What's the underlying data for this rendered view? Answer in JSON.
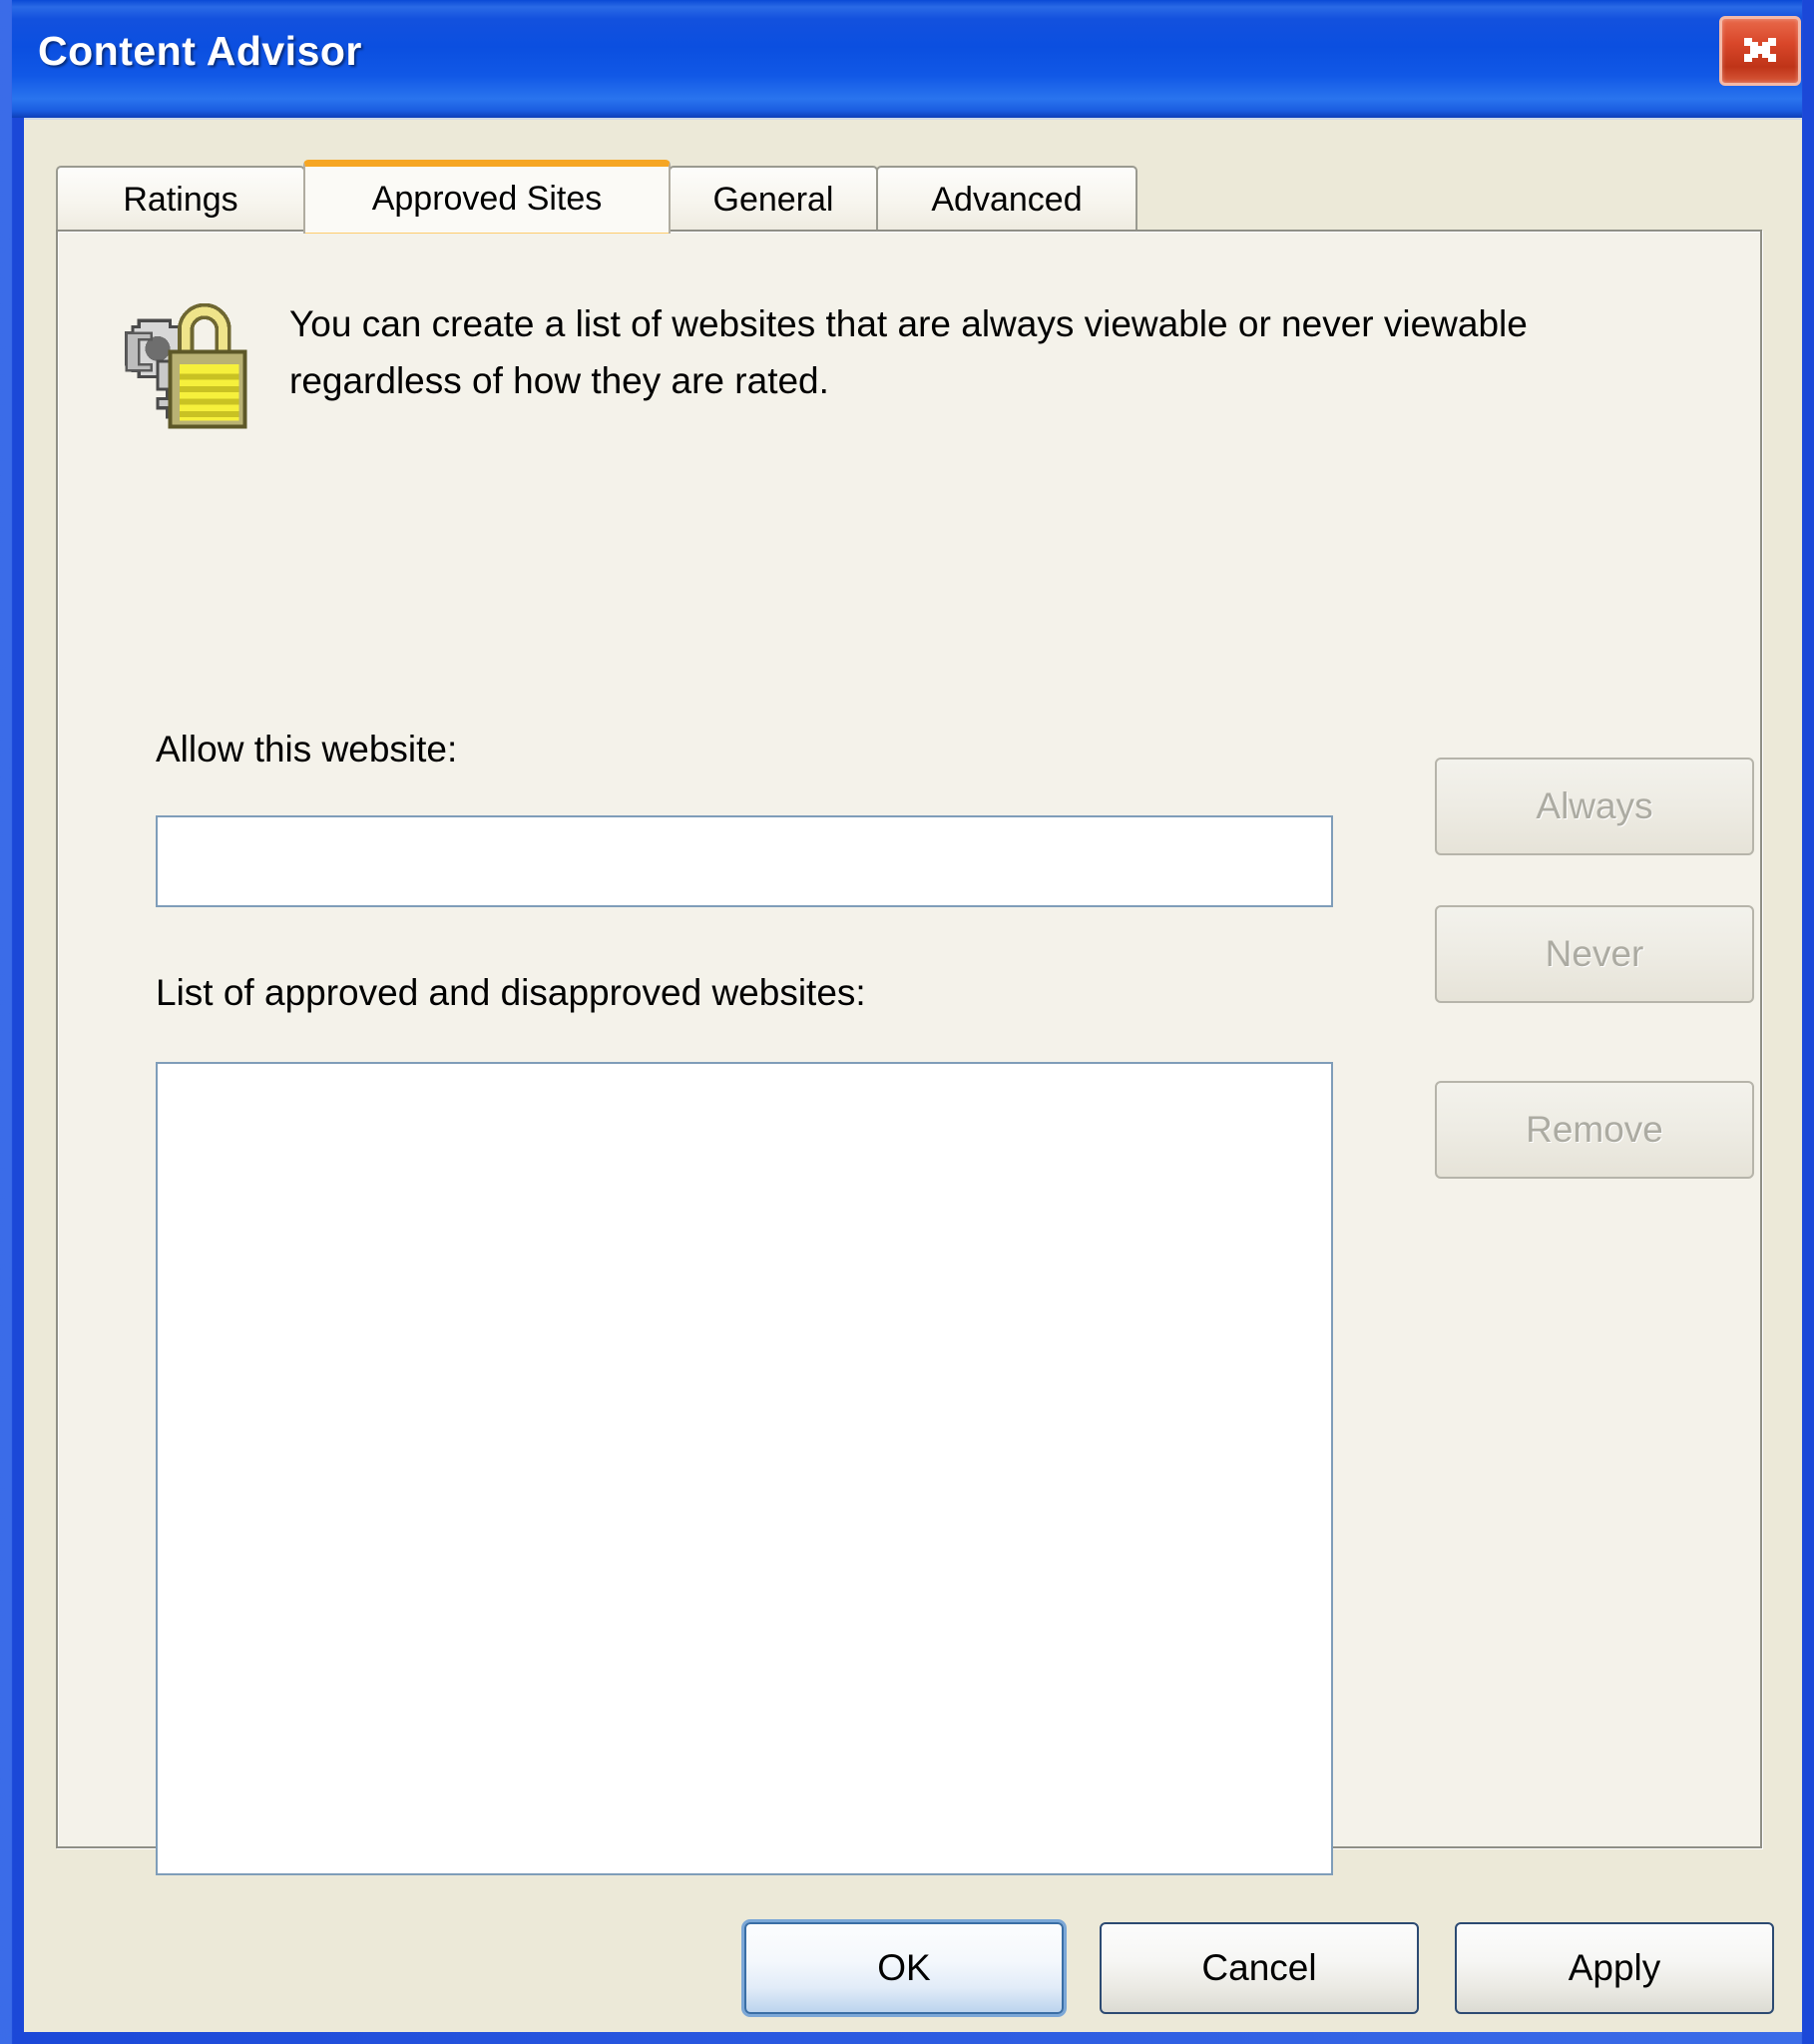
{
  "window": {
    "title": "Content Advisor",
    "close_icon": "close-icon",
    "accent_orange": "#f6a623",
    "titlebar_blue": "#0b4fe0",
    "dialog_background": "#ece9d8",
    "panel_background": "#f4f2ea",
    "field_border": "#7f9db9"
  },
  "tabs": [
    {
      "label": "Ratings",
      "name": "tab-ratings",
      "active": false
    },
    {
      "label": "Approved Sites",
      "name": "tab-approved-sites",
      "active": true
    },
    {
      "label": "General",
      "name": "tab-general",
      "active": false
    },
    {
      "label": "Advanced",
      "name": "tab-advanced",
      "active": false
    }
  ],
  "panel": {
    "icon": "padlock-with-keys-icon",
    "description": "You can create a list of websites that are always viewable or never viewable regardless of how they are rated.",
    "allow_label": "Allow this website:",
    "allow_value": "",
    "allow_placeholder": "",
    "list_label": "List of approved and disapproved websites:",
    "list_items": [],
    "side_buttons": [
      {
        "label": "Always",
        "name": "always-button",
        "enabled": false
      },
      {
        "label": "Never",
        "name": "never-button",
        "enabled": false
      },
      {
        "label": "Remove",
        "name": "remove-button",
        "enabled": false
      }
    ]
  },
  "footer": {
    "ok_label": "OK",
    "cancel_label": "Cancel",
    "apply_label": "Apply"
  }
}
